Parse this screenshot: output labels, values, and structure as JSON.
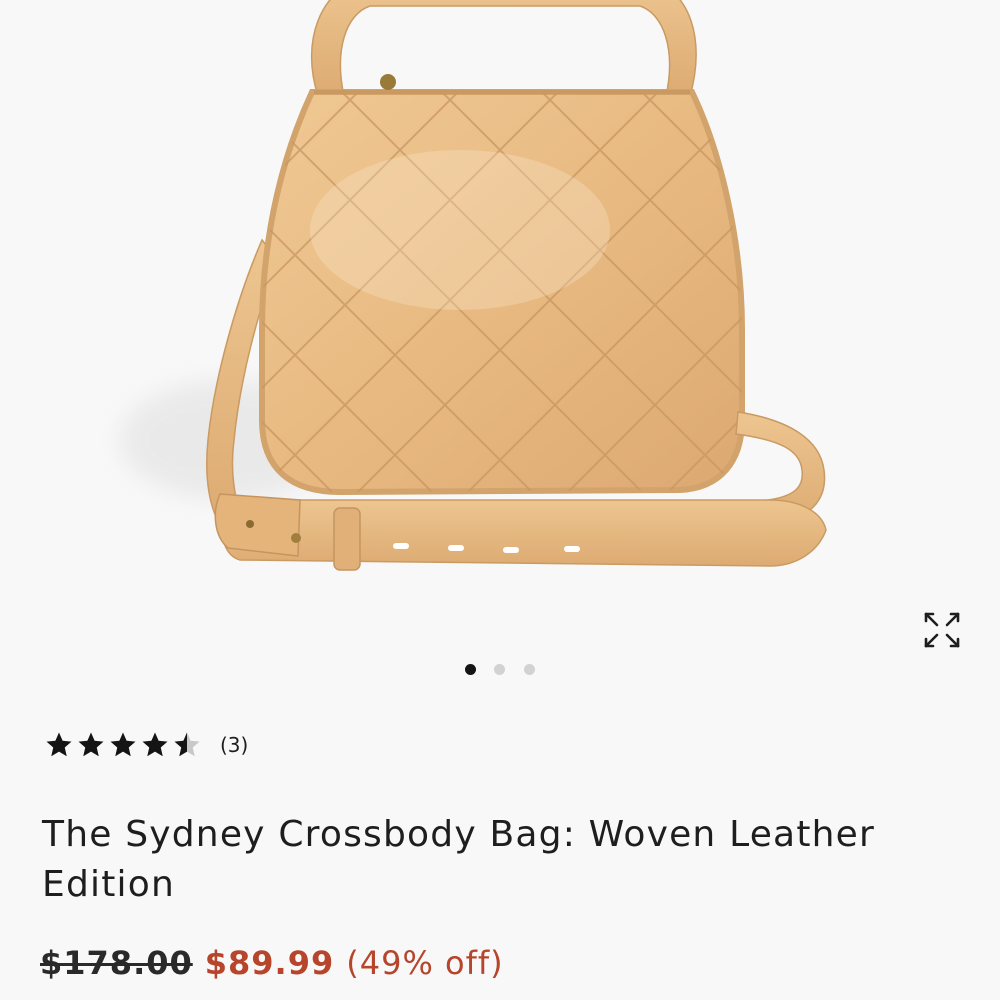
{
  "product": {
    "title": "The Sydney Crossbody Bag: Woven Leather Edition",
    "image_alt": "Tan woven leather crossbody bag",
    "rating": {
      "value": 4.5,
      "max": 5,
      "count_label": "(3)"
    },
    "price": {
      "original": "$178.00",
      "sale": "$89.99",
      "discount": "(49% off)"
    }
  },
  "gallery": {
    "slide_count": 3,
    "active_slide": 1
  },
  "icons": {
    "expand": "expand-icon",
    "star": "star-icon"
  },
  "colors": {
    "sale": "#b6452c",
    "leather": "#e8bb83",
    "star_filled": "#141414",
    "star_empty": "#c8c8c8",
    "background": "#f8f8f8"
  }
}
